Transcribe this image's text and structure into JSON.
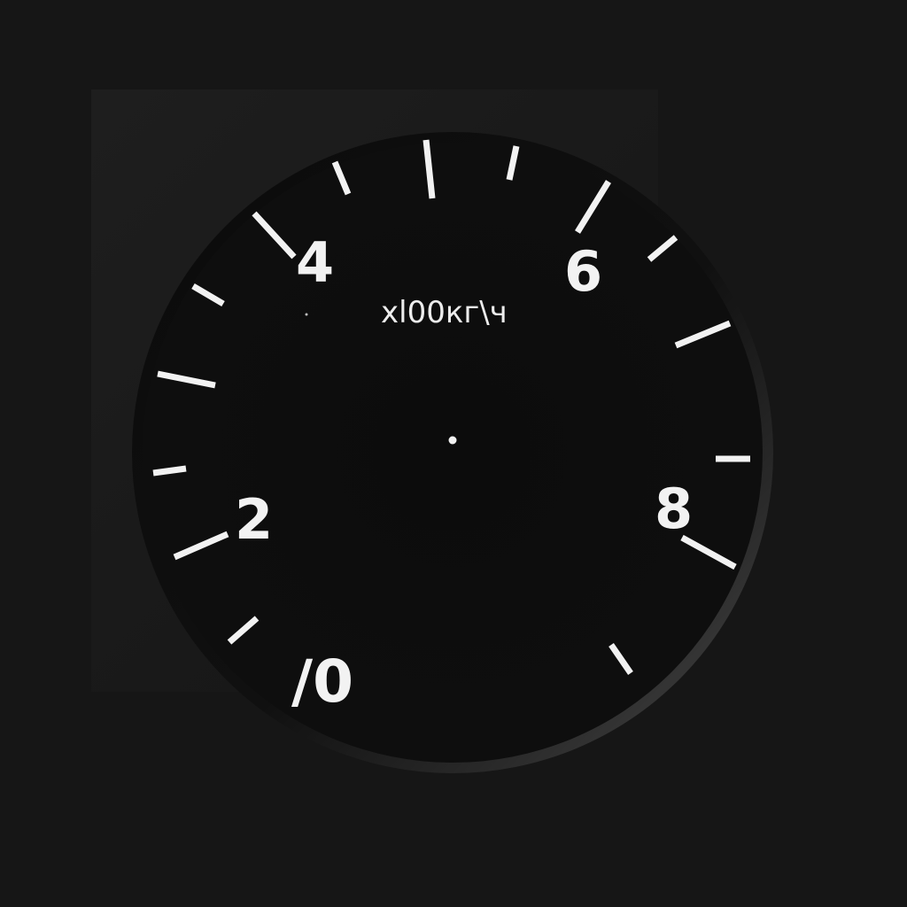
{
  "gauge": {
    "unit_label": "xl00кг\\ч",
    "scale_labels": [
      {
        "id": "0",
        "text": "/0"
      },
      {
        "id": "2",
        "text": "2"
      },
      {
        "id": "4",
        "text": "4"
      },
      {
        "id": "6",
        "text": "6"
      },
      {
        "id": "8",
        "text": "8"
      }
    ],
    "colors": {
      "background": "#161616",
      "dial_face": "#0d0d0d",
      "bezel_dark": "#0b0b0b",
      "bezel_light": "#4a4a4a",
      "markings": "#f2f2f2"
    }
  }
}
